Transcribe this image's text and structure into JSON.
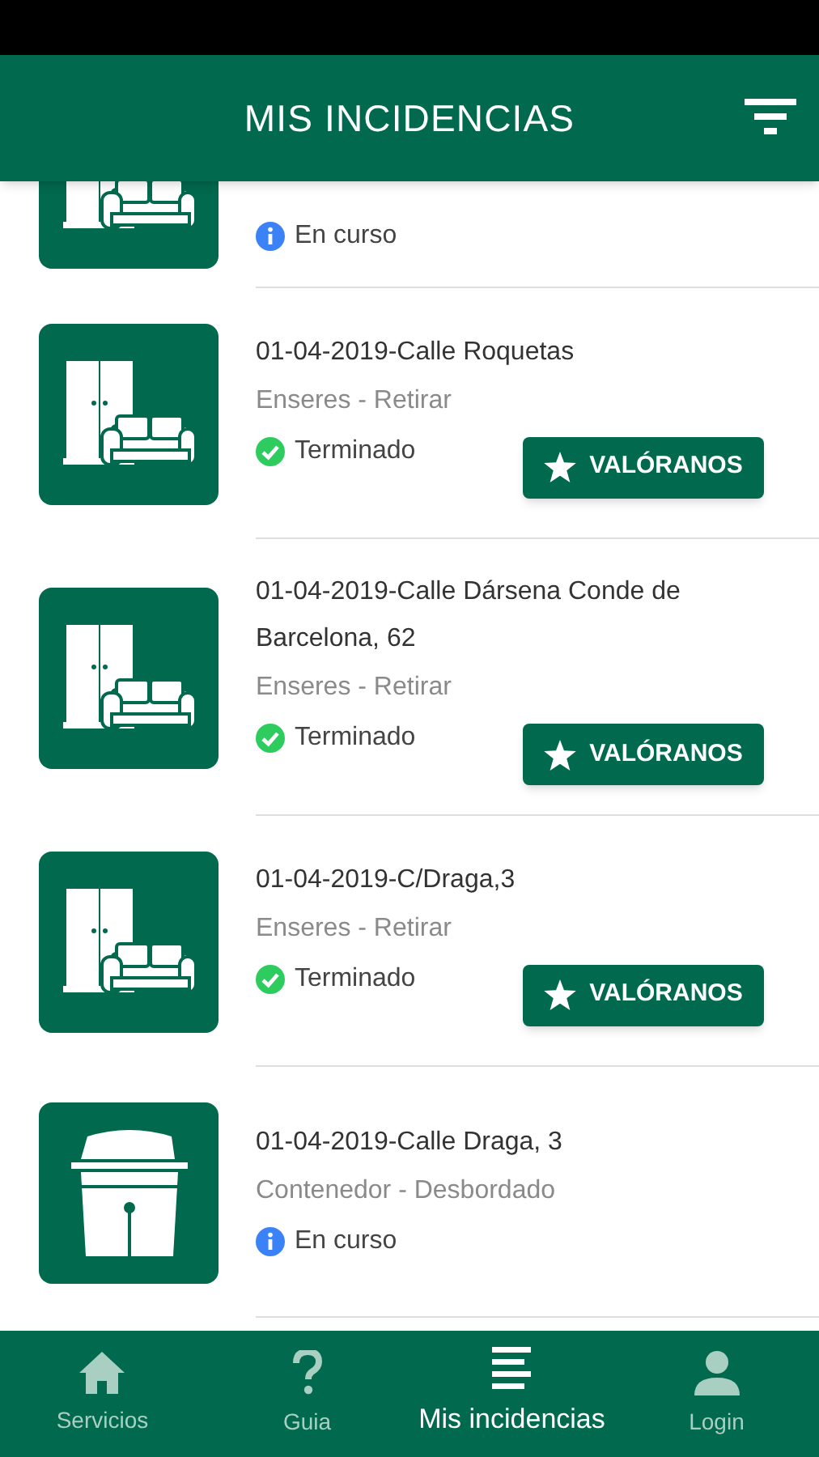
{
  "header": {
    "title": "MIS INCIDENCIAS"
  },
  "incidents": [
    {
      "kind": "furniture",
      "status": {
        "kind": "in_progress",
        "label": "En curso"
      }
    },
    {
      "kind": "furniture",
      "title": "01-04-2019-Calle Roquetas",
      "subtitle": "Enseres - Retirar",
      "status": {
        "kind": "done",
        "label": "Terminado"
      },
      "rate_button": "VALÓRANOS"
    },
    {
      "kind": "furniture",
      "title": "01-04-2019-Calle Dársena Conde de Barcelona, 62",
      "subtitle": "Enseres - Retirar",
      "status": {
        "kind": "done",
        "label": "Terminado"
      },
      "rate_button": "VALÓRANOS"
    },
    {
      "kind": "furniture",
      "title": "01-04-2019-C/Draga,3",
      "subtitle": "Enseres - Retirar",
      "status": {
        "kind": "done",
        "label": "Terminado"
      },
      "rate_button": "VALÓRANOS"
    },
    {
      "kind": "container",
      "title": "01-04-2019-Calle Draga, 3",
      "subtitle": "Contenedor - Desbordado",
      "status": {
        "kind": "in_progress",
        "label": "En curso"
      }
    }
  ],
  "bottom_nav": [
    {
      "kind": "home",
      "label": "Servicios",
      "selected": false
    },
    {
      "kind": "help",
      "label": "Guia",
      "selected": false
    },
    {
      "kind": "list",
      "label": "Mis incidencias",
      "selected": true
    },
    {
      "kind": "person",
      "label": "Login",
      "selected": false
    }
  ]
}
